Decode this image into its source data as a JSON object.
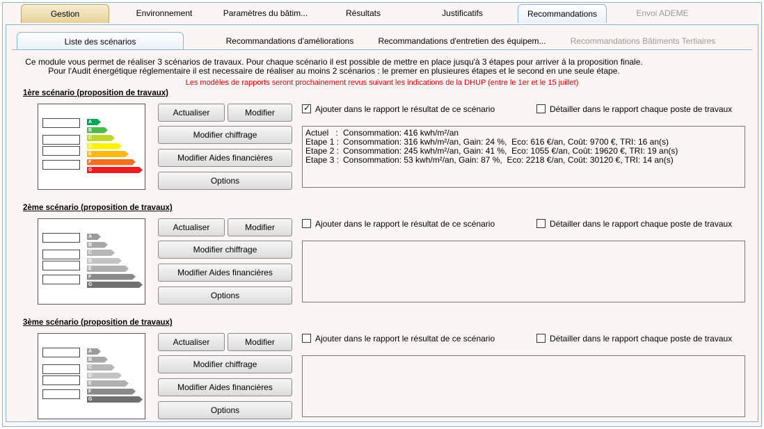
{
  "tabs": [
    {
      "label": "Gestion",
      "state": "active-gold"
    },
    {
      "label": "Environnement",
      "state": ""
    },
    {
      "label": "Paramètres du bâtim...",
      "state": ""
    },
    {
      "label": "Résultats",
      "state": ""
    },
    {
      "label": "Justificatifs",
      "state": ""
    },
    {
      "label": "Recommandations",
      "state": "active-blue"
    },
    {
      "label": "Envoi ADEME",
      "state": "disabled"
    }
  ],
  "subtabs": [
    {
      "label": "Liste des scénarios",
      "state": "active"
    },
    {
      "label": "Recommandations d'améliorations",
      "state": ""
    },
    {
      "label": "Recommandations d'entretien des équipem...",
      "state": ""
    },
    {
      "label": "Recommandations Bâtiments Tertiaires",
      "state": "disabled"
    }
  ],
  "intro": {
    "line1": "Ce module vous permet de réaliser 3 scénarios de travaux. Pour chaque scénario il est possible de mettre en place jusqu'à 3 étapes pour arriver à la proposition finale.",
    "line2": "Pour l'Audit énergétique réglementaire il est necessaire de réaliser au moins 2 scénarios : le premer en plusieures étapes et le second en une seule étape."
  },
  "notice": "Les modèles de rapports seront prochainement revus suivant les indications de la DHUP (entre le 1er et le 15 juillet)",
  "labels": {
    "actualiser": "Actualiser",
    "modifier": "Modifier",
    "modifier_chiffrage": "Modifier chiffrage",
    "modifier_aides": "Modifier Aides financières",
    "options": "Options",
    "ajouter": "Ajouter dans le rapport le résultat de ce scénario",
    "detailler": "Détailler dans le rapport chaque poste de travaux"
  },
  "energy_classes": [
    "A",
    "B",
    "C",
    "D",
    "E",
    "F",
    "G"
  ],
  "class_colors": [
    "#00a651",
    "#50b848",
    "#bed730",
    "#fff200",
    "#fdb913",
    "#f37021",
    "#ed1c24"
  ],
  "grey_colors": [
    "#9a9a9a",
    "#a8a8a8",
    "#b6b6b6",
    "#c4c4c4",
    "#b0b0b0",
    "#8a8a8a",
    "#707070"
  ],
  "scenarios": [
    {
      "title": "1ère scénario (proposition de travaux)",
      "ajouter_checked": true,
      "detailler_checked": false,
      "colored": true,
      "results": [
        {
          "label": "Actuel   :",
          "text": "Consommation: 416 kwh/m²/an"
        },
        {
          "label": "Etape 1 :",
          "text": "Consommation: 316 kwh/m²/an, Gain: 24 %,  Eco: 616 €/an, Coût: 9700 €, TRI: 16 an(s)"
        },
        {
          "label": "Etape 2 :",
          "text": "Consommation: 245 kwh/m²/an, Gain: 41 %,  Eco: 1055 €/an, Coût: 19620 €, TRI: 19 an(s)"
        },
        {
          "label": "Etape 3 :",
          "text": "Consommation: 53 kwh/m²/an, Gain: 87 %,  Eco: 2218 €/an, Coût: 30120 €, TRI: 14 an(s)"
        }
      ]
    },
    {
      "title": "2ème scénario (proposition de travaux)",
      "ajouter_checked": false,
      "detailler_checked": false,
      "colored": false,
      "results": []
    },
    {
      "title": "3ème scénario (proposition de travaux)",
      "ajouter_checked": false,
      "detailler_checked": false,
      "colored": false,
      "results": []
    }
  ]
}
